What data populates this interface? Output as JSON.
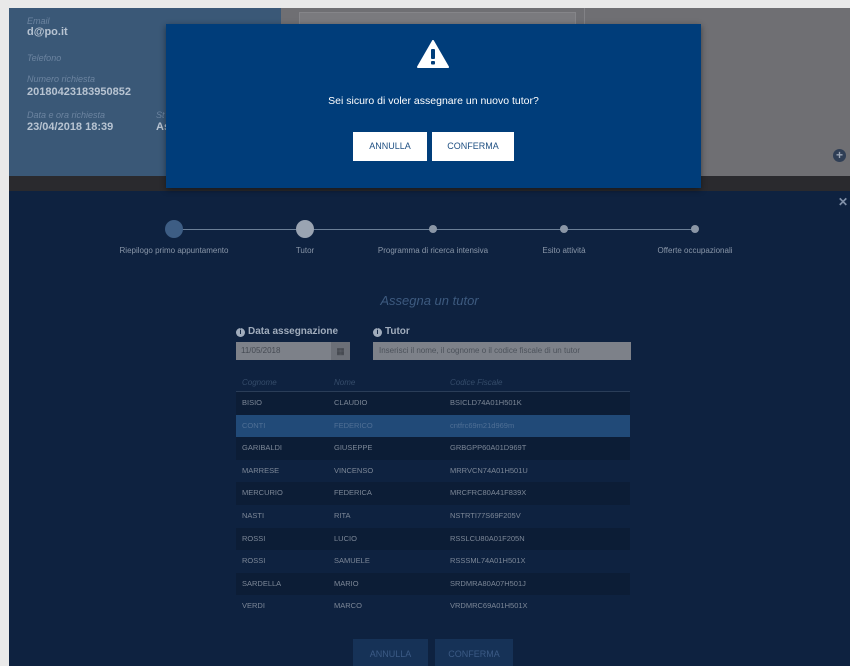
{
  "info": {
    "email_label": "Email",
    "email_value": "d@po.it",
    "phone_label": "Telefono",
    "request_number_label": "Numero richiesta",
    "request_number_value": "20180423183950852",
    "request_datetime_label": "Data e ora richiesta",
    "request_datetime_value": "23/04/2018 18:39",
    "partial_label": "St",
    "partial_value": "As"
  },
  "stepper": {
    "steps": [
      {
        "label": "Riepilogo primo appuntamento"
      },
      {
        "label": "Tutor"
      },
      {
        "label": "Programma di ricerca intensiva"
      },
      {
        "label": "Esito attività"
      },
      {
        "label": "Offerte occupazionali"
      }
    ],
    "active_index": 1
  },
  "assign": {
    "title": "Assegna un tutor",
    "date_label": "Data assegnazione",
    "date_value": "11/05/2018",
    "tutor_label": "Tutor",
    "tutor_placeholder": "Inserisci il nome, il cognome o il codice fiscale di un tutor"
  },
  "table": {
    "headers": [
      "Cognome",
      "Nome",
      "Codice Fiscale"
    ],
    "rows": [
      {
        "cognome": "BISIO",
        "nome": "CLAUDIO",
        "cf": "BSICLD74A01H501K"
      },
      {
        "cognome": "CONTI",
        "nome": "FEDERICO",
        "cf": "cntfrc69m21d969m"
      },
      {
        "cognome": "GARIBALDI",
        "nome": "GIUSEPPE",
        "cf": "GRBGPP60A01D969T"
      },
      {
        "cognome": "MARRESE",
        "nome": "VINCENSO",
        "cf": "MRRVCN74A01H501U"
      },
      {
        "cognome": "MERCURIO",
        "nome": "FEDERICA",
        "cf": "MRCFRC80A41F839X"
      },
      {
        "cognome": "NASTI",
        "nome": "RITA",
        "cf": "NSTRTI77S69F205V"
      },
      {
        "cognome": "ROSSI",
        "nome": "LUCIO",
        "cf": "RSSLCU80A01F205N"
      },
      {
        "cognome": "ROSSI",
        "nome": "SAMUELE",
        "cf": "RSSSML74A01H501X"
      },
      {
        "cognome": "SARDELLA",
        "nome": "MARIO",
        "cf": "SRDMRA80A07H501J"
      },
      {
        "cognome": "VERDI",
        "nome": "MARCO",
        "cf": "VRDMRC69A01H501X"
      }
    ],
    "selected_index": 1
  },
  "footer": {
    "cancel_label": "ANNULLA",
    "confirm_label": "CONFERMA"
  },
  "dialog": {
    "icon": "warning-icon",
    "message": "Sei sicuro di voler assegnare un nuovo tutor?",
    "cancel_label": "ANNULLA",
    "confirm_label": "CONFERMA"
  },
  "colors": {
    "dialog_bg": "#003d7a",
    "overlay_bg": "#0e2240",
    "selected_row": "#214a78"
  }
}
